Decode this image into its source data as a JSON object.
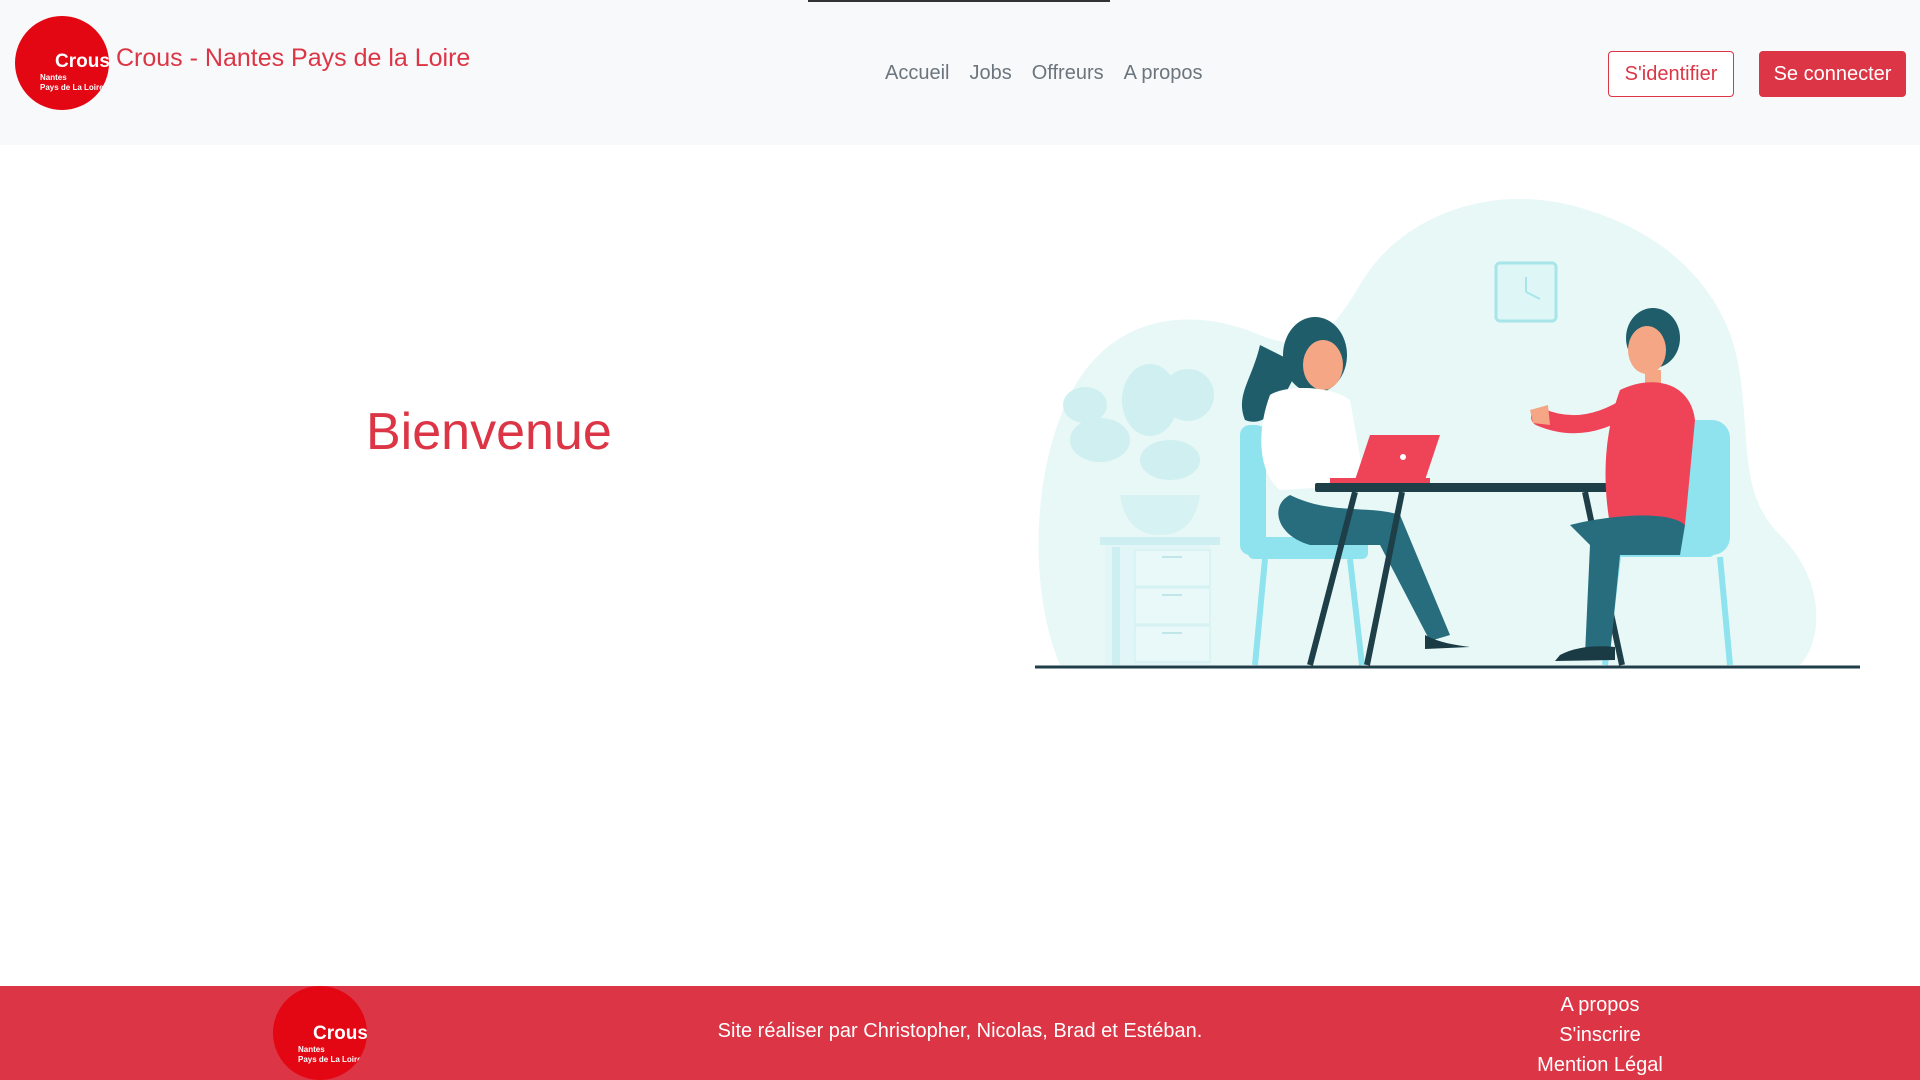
{
  "header": {
    "logo": {
      "word": "Crous",
      "line1": "Nantes",
      "line2": "Pays de La Loire"
    },
    "brand": "Crous - Nantes Pays de la Loire",
    "nav": [
      {
        "label": "Accueil"
      },
      {
        "label": "Jobs"
      },
      {
        "label": "Offreurs"
      },
      {
        "label": "A propos"
      }
    ],
    "identify_label": "S'identifier",
    "connect_label": "Se connecter"
  },
  "main": {
    "heading": "Bienvenue"
  },
  "footer": {
    "logo": {
      "word": "Crous",
      "line1": "Nantes",
      "line2": "Pays de La Loire"
    },
    "credits": "Site réaliser par Christopher, Nicolas, Brad et Estéban.",
    "links": [
      {
        "label": "A propos"
      },
      {
        "label": "S'inscrire"
      },
      {
        "label": "Mention Légal"
      }
    ]
  },
  "colors": {
    "primary": "#dc3545",
    "logo_red": "#e30613",
    "navbar_bg": "#f8f9fa",
    "muted_text": "#6c757d"
  }
}
